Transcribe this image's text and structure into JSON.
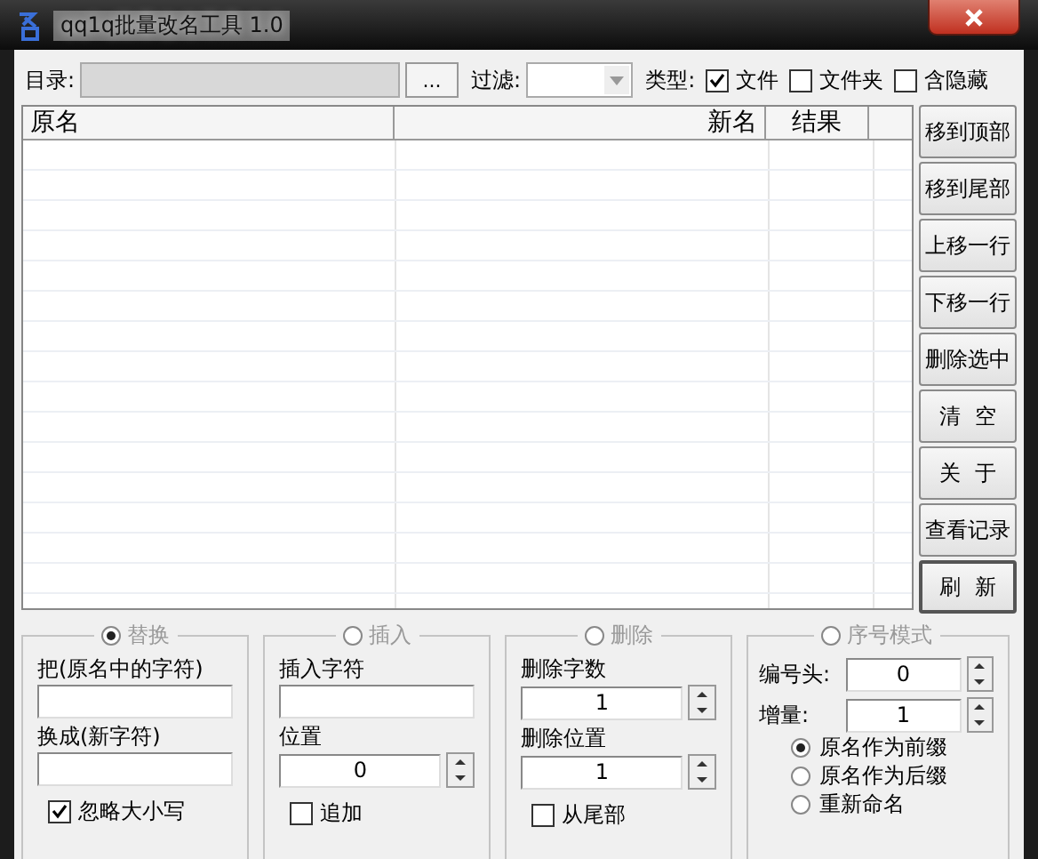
{
  "window": {
    "title": "qq1q批量改名工具 1.0"
  },
  "toolbar": {
    "dir_label": "目录:",
    "browse_button": "...",
    "filter_label": "过滤:",
    "type_label": "类型:",
    "types": [
      {
        "label": "文件",
        "checked": true
      },
      {
        "label": "文件夹",
        "checked": false
      },
      {
        "label": "含隐藏",
        "checked": false
      }
    ]
  },
  "table": {
    "columns": [
      "原名",
      "新名",
      "结果"
    ]
  },
  "side_buttons": [
    {
      "label": "移到顶部",
      "default": false
    },
    {
      "label": "移到尾部",
      "default": false
    },
    {
      "label": "上移一行",
      "default": false
    },
    {
      "label": "下移一行",
      "default": false
    },
    {
      "label": "删除选中",
      "default": false
    },
    {
      "label": "清  空",
      "default": false
    },
    {
      "label": "关  于",
      "default": false
    },
    {
      "label": "查看记录",
      "default": false
    },
    {
      "label": "刷  新",
      "default": true
    }
  ],
  "replace": {
    "title": "替换",
    "selected": true,
    "find_label": "把(原名中的字符)",
    "replace_label": "换成(新字符)",
    "ignore_case": {
      "label": "忽略大小写",
      "checked": true
    }
  },
  "insert": {
    "title": "插入",
    "selected": false,
    "text_label": "插入字符",
    "position_label": "位置",
    "position_value": "0",
    "append": {
      "label": "追加",
      "checked": false
    }
  },
  "delete": {
    "title": "删除",
    "selected": false,
    "count_label": "删除字数",
    "count_value": "1",
    "position_label": "删除位置",
    "position_value": "1",
    "from_end": {
      "label": "从尾部",
      "checked": false
    }
  },
  "sequence": {
    "title": "序号模式",
    "selected": false,
    "start_label": "编号头:",
    "start_value": "0",
    "step_label": "增量:",
    "step_value": "1",
    "modes": [
      {
        "label": "原名作为前缀",
        "selected": true
      },
      {
        "label": "原名作为后缀",
        "selected": false
      },
      {
        "label": "重新命名",
        "selected": false
      }
    ]
  }
}
